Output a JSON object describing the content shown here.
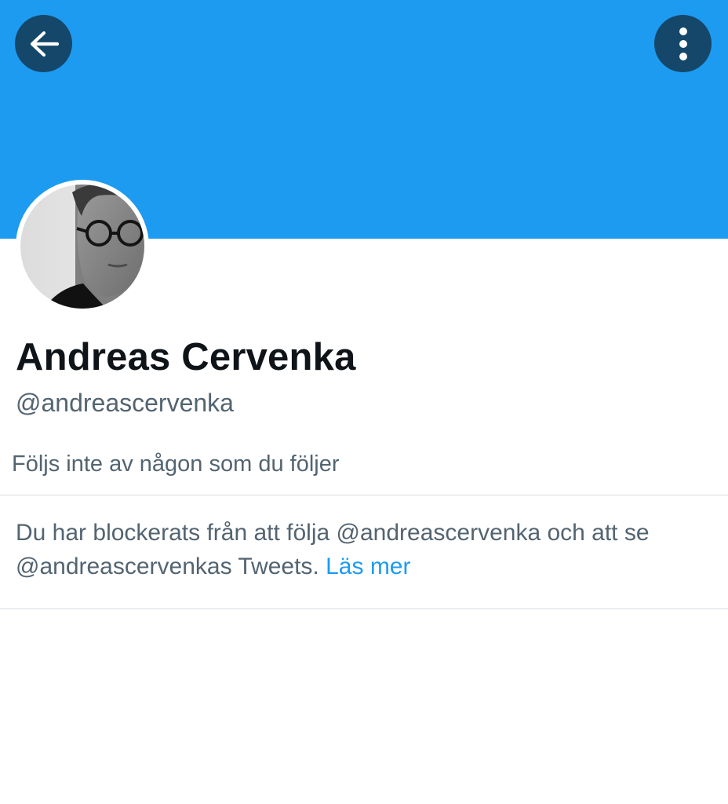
{
  "colors": {
    "banner": "#1d9bf0",
    "text_primary": "#0f1419",
    "text_secondary": "#536471",
    "link": "#1d9bf0",
    "divider": "#d6dbdf"
  },
  "header": {
    "back_icon": "arrow-left-icon",
    "more_icon": "vertical-ellipsis-icon"
  },
  "profile": {
    "display_name": "Andreas Cervenka",
    "handle": "@andreascervenka",
    "followers_you_know": "Följs inte av någon som du följer",
    "avatar_icon": "profile-photo"
  },
  "blocked_notice": {
    "line1": "Du har blockerats från att följa @andreascervenka och att se",
    "line2_prefix": "@andreascervenkas Tweets. ",
    "link_label": "Läs mer"
  }
}
